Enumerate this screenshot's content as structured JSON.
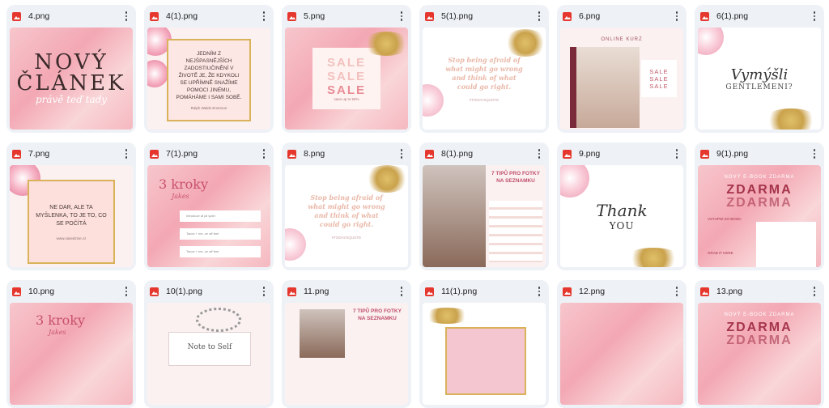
{
  "files": [
    {
      "name": "4.png",
      "text": [
        "NOVÝ",
        "ČLÁNEK",
        "právě teď tady"
      ]
    },
    {
      "name": "4(1).png",
      "text": [
        "JEDNÍM Z NEJŠPASNĚJŠÍCH ZADOSTIUČINĚNÍ V ŽIVOTĚ JE, ŽE KDYKOLI SE UPŘÍMNĚ SNAŽÍME POMOCI JINÉMU, POMÁHÁME I SAMI SOBĚ.",
        "Ralph Waldo Emerson"
      ]
    },
    {
      "name": "5.png",
      "text": [
        "SALE",
        "SALE",
        "SALE",
        "save up to 50%"
      ]
    },
    {
      "name": "5(1).png",
      "text": [
        "Stop being afraid of what might go wrong and think of what could go right.",
        "#TODAYSQUOTE"
      ]
    },
    {
      "name": "6.png",
      "text": [
        "ONLINE KURZ",
        "SALE",
        "SALE",
        "SALE"
      ]
    },
    {
      "name": "6(1).png",
      "text": [
        "Vymýšli",
        "GENTLEMENI?"
      ]
    },
    {
      "name": "7.png",
      "text": [
        "NE DAR, ALE TA MYŠLENKA, TO JE TO, CO SE POČÍTÁ",
        "www.vasedzine.cz"
      ]
    },
    {
      "name": "7(1).png",
      "text": [
        "3 kroky",
        "Jakes",
        "Introduce at pil spiel",
        "Tacos + me, ve off feel",
        "Tacos + me, ve off feel"
      ]
    },
    {
      "name": "8.png",
      "text": [
        "Stop being afraid of what might go wrong and think of what could go right.",
        "#TODAYSQUOTE"
      ]
    },
    {
      "name": "8(1).png",
      "text": [
        "7 TIPŮ PRO FOTKY NA SEZNAMKU"
      ]
    },
    {
      "name": "9.png",
      "text": [
        "Thank",
        "YOU"
      ]
    },
    {
      "name": "9(1).png",
      "text": [
        "NOVÝ E-BOOK ZDARMA",
        "ZDARMA",
        "ZDARMA",
        "VSTUPNÍ ZO BOOK:",
        "GRAB IT HERE"
      ]
    },
    {
      "name": "10.png",
      "text": [
        "3 kroky",
        "Jakes"
      ]
    },
    {
      "name": "10(1).png",
      "text": [
        "Note to Self"
      ]
    },
    {
      "name": "11.png",
      "text": [
        "7 TIPŮ PRO FOTKY NA SEZNAMKU"
      ]
    },
    {
      "name": "11(1).png",
      "text": []
    },
    {
      "name": "12.png",
      "text": []
    },
    {
      "name": "13.png",
      "text": [
        "NOVÝ E-BOOK ZDARMA",
        "ZDARMA",
        "ZDARMA"
      ]
    }
  ],
  "colors": {
    "card_bg": "#eef1f6",
    "icon_red": "#e5372d",
    "pink": "#f3a8b4",
    "gold": "#d9b25a"
  },
  "icons": {
    "file": "image-file-icon",
    "more": "more-vert-icon"
  }
}
